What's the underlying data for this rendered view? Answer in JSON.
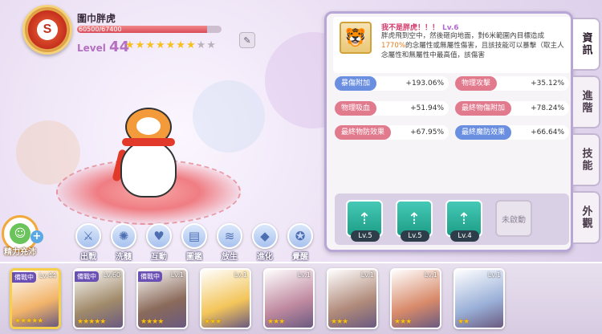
{
  "hero": {
    "rank": "S",
    "name": "圍巾胖虎",
    "exp_text": "60500/67400",
    "exp_fraction": 0.9,
    "level_label": "Level",
    "level": "44",
    "stars_filled": 7,
    "stars_total": 9
  },
  "energy": {
    "label": "精力充沛",
    "plus": "+"
  },
  "actions": [
    {
      "label": "出戰",
      "icon": "crossed-swords-icon"
    },
    {
      "label": "洗髓",
      "icon": "orb-icon"
    },
    {
      "label": "互動",
      "icon": "heart-icon"
    },
    {
      "label": "圖鑑",
      "icon": "book-icon"
    },
    {
      "label": "放生",
      "icon": "fish-icon"
    },
    {
      "label": "進化",
      "icon": "crystal-icon"
    },
    {
      "label": "覺醒",
      "icon": "awaken-icon"
    }
  ],
  "skill": {
    "title": "我不是胖虎！！！",
    "level": "Lv.6",
    "desc_a": "胖虎飛到空中，然後砸向地面，對6米範圍內目標造成",
    "desc_highlight": "1770%",
    "desc_b": "的念屬性或無屬性傷害，且該技能可以暴擊（取主人念屬性和無屬性中最高值，該傷害"
  },
  "stats": [
    {
      "key": "暴傷附加",
      "value": "+193.06%",
      "color": "blue"
    },
    {
      "key": "物理攻擊",
      "value": "+35.12%",
      "color": "red"
    },
    {
      "key": "物理吸血",
      "value": "+51.94%",
      "color": "red"
    },
    {
      "key": "最終物傷附加",
      "value": "+78.24%",
      "color": "red"
    },
    {
      "key": "最終物防效果",
      "value": "+67.95%",
      "color": "red"
    },
    {
      "key": "最終魔防效果",
      "value": "+66.64%",
      "color": "blue"
    }
  ],
  "gems": [
    {
      "level": "Lv.5"
    },
    {
      "level": "Lv.5"
    },
    {
      "level": "Lv.4"
    }
  ],
  "gem_locked_label": "未啟動",
  "tabs": [
    "資訊",
    "進階",
    "技能",
    "外觀"
  ],
  "roster": [
    {
      "level": "Lv.44",
      "tag": "備戰中",
      "stars": "★★★★★",
      "color": "#f2b46a",
      "selected": true
    },
    {
      "level": "Lv.60",
      "tag": "備戰中",
      "stars": "★★★★★",
      "color": "#a08a6a",
      "selected": false
    },
    {
      "level": "Lv.1",
      "tag": "備戰中",
      "stars": "★★★★",
      "color": "#8a6a5a",
      "selected": false
    },
    {
      "level": "Lv.1",
      "tag": "",
      "stars": "★★★",
      "color": "#f3c55a",
      "selected": false
    },
    {
      "level": "Lv.1",
      "tag": "",
      "stars": "★★★",
      "color": "#c08aa0",
      "selected": false
    },
    {
      "level": "Lv.1",
      "tag": "",
      "stars": "★★★",
      "color": "#b08a7a",
      "selected": false
    },
    {
      "level": "Lv.1",
      "tag": "",
      "stars": "★★★",
      "color": "#d88a6a",
      "selected": false
    },
    {
      "level": "Lv.1",
      "tag": "",
      "stars": "★★",
      "color": "#9ab0d8",
      "selected": false
    }
  ]
}
